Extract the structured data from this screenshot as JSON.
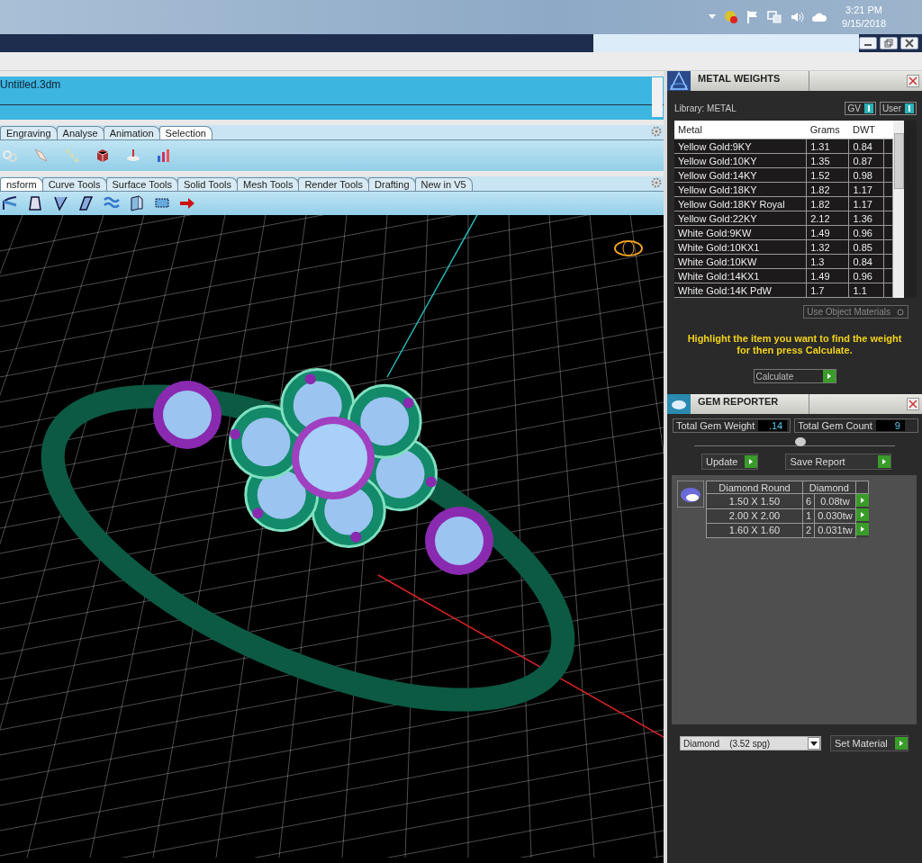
{
  "taskbar": {
    "time": "3:21 PM",
    "date": "9/15/2018"
  },
  "command_area": {
    "filename": "Untitled.3dm"
  },
  "toolbar_tabs_top": [
    {
      "label": "Engraving",
      "selected": false
    },
    {
      "label": "Analyse",
      "selected": false
    },
    {
      "label": "Animation",
      "selected": false
    },
    {
      "label": "Selection",
      "selected": true
    }
  ],
  "toolbar_tabs_bottom": [
    {
      "label": "nsform",
      "selected": true
    },
    {
      "label": "Curve Tools",
      "selected": false
    },
    {
      "label": "Surface Tools",
      "selected": false
    },
    {
      "label": "Solid Tools",
      "selected": false
    },
    {
      "label": "Mesh Tools",
      "selected": false
    },
    {
      "label": "Render Tools",
      "selected": false
    },
    {
      "label": "Drafting",
      "selected": false
    },
    {
      "label": "New in V5",
      "selected": false
    }
  ],
  "metal_weights": {
    "title": "METAL WEIGHTS",
    "library": "Library: METAL",
    "toggles": [
      {
        "label": "GV",
        "on": true
      },
      {
        "label": "User",
        "on": true
      }
    ],
    "columns": [
      "Metal",
      "Grams",
      "DWT"
    ],
    "rows": [
      {
        "metal": "Yellow Gold:9KY",
        "grams": "1.31",
        "dwt": "0.84"
      },
      {
        "metal": "Yellow Gold:10KY",
        "grams": "1.35",
        "dwt": "0.87"
      },
      {
        "metal": "Yellow Gold:14KY",
        "grams": "1.52",
        "dwt": "0.98"
      },
      {
        "metal": "Yellow Gold:18KY",
        "grams": "1.82",
        "dwt": "1.17"
      },
      {
        "metal": "Yellow Gold:18KY Royal",
        "grams": "1.82",
        "dwt": "1.17"
      },
      {
        "metal": "Yellow Gold:22KY",
        "grams": "2.12",
        "dwt": "1.36"
      },
      {
        "metal": "White Gold:9KW",
        "grams": "1.49",
        "dwt": "0.96"
      },
      {
        "metal": "White Gold:10KX1",
        "grams": "1.32",
        "dwt": "0.85"
      },
      {
        "metal": "White Gold:10KW",
        "grams": "1.3",
        "dwt": "0.84"
      },
      {
        "metal": "White Gold:14KX1",
        "grams": "1.49",
        "dwt": "0.96"
      },
      {
        "metal": "White Gold:14K PdW",
        "grams": "1.7",
        "dwt": "1.1"
      }
    ],
    "use_object_materials": "Use Object Materials",
    "hint": "Highlight the item you want to find the weight for then press Calculate.",
    "calculate": "Calculate"
  },
  "gem_reporter": {
    "title": "GEM REPORTER",
    "total_weight_label": "Total Gem Weight",
    "total_weight": ".14",
    "total_count_label": "Total Gem Count",
    "total_count": "9",
    "buttons": [
      "Update",
      "Save Report"
    ],
    "shape": "Diamond Round",
    "material": "Diamond",
    "rows": [
      {
        "size": "1.50 X 1.50",
        "count": "6",
        "weight": "0.08tw"
      },
      {
        "size": "2.00 X 2.00",
        "count": "1",
        "weight": "0.030tw"
      },
      {
        "size": "1.60 X 1.60",
        "count": "2",
        "weight": "0.031tw"
      }
    ],
    "material_select": "Diamond    (3.52 spg)",
    "set_material": "Set Material"
  }
}
